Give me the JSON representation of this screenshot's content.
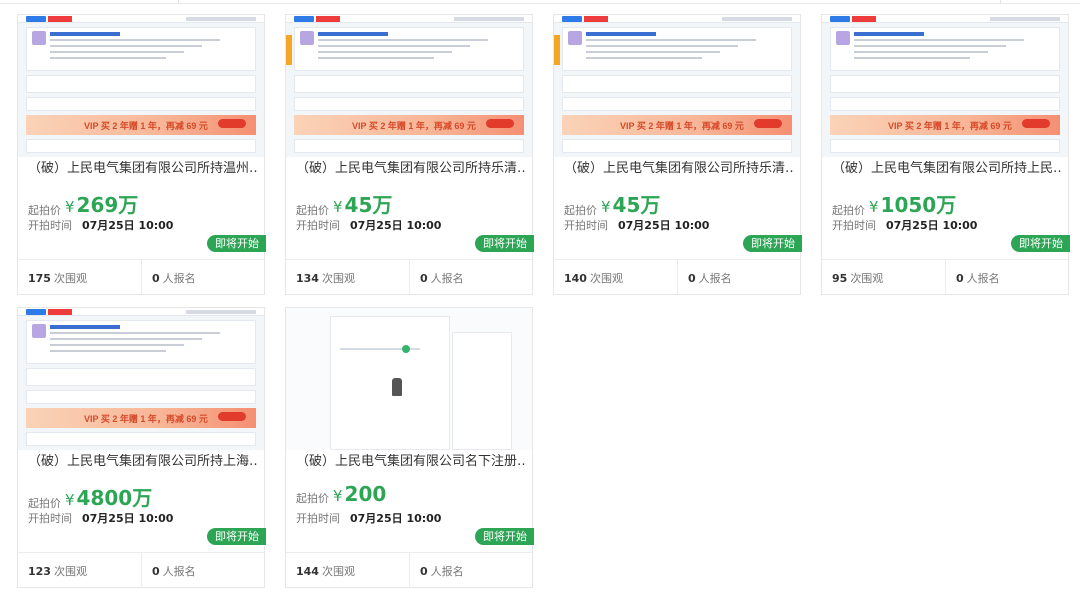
{
  "auctions": [
    {
      "title": "（破）上民电气集团有限公司所持温州…",
      "price_label": "起拍价",
      "currency": "¥",
      "price": "269万",
      "time_label": "开拍时间",
      "time": "07月25日 10:00",
      "status": "即将开始",
      "views": "175",
      "views_label": "次围观",
      "signups": "0",
      "signups_label": "人报名"
    },
    {
      "title": "（破）上民电气集团有限公司所持乐清…",
      "price_label": "起拍价",
      "currency": "¥",
      "price": "45万",
      "time_label": "开拍时间",
      "time": "07月25日 10:00",
      "status": "即将开始",
      "views": "134",
      "views_label": "次围观",
      "signups": "0",
      "signups_label": "人报名"
    },
    {
      "title": "（破）上民电气集团有限公司所持乐清…",
      "price_label": "起拍价",
      "currency": "¥",
      "price": "45万",
      "time_label": "开拍时间",
      "time": "07月25日 10:00",
      "status": "即将开始",
      "views": "140",
      "views_label": "次围观",
      "signups": "0",
      "signups_label": "人报名"
    },
    {
      "title": "（破）上民电气集团有限公司所持上民…",
      "price_label": "起拍价",
      "currency": "¥",
      "price": "1050万",
      "time_label": "开拍时间",
      "time": "07月25日 10:00",
      "status": "即将开始",
      "views": "95",
      "views_label": "次围观",
      "signups": "0",
      "signups_label": "人报名"
    },
    {
      "title": "（破）上民电气集团有限公司所持上海…",
      "price_label": "起拍价",
      "currency": "¥",
      "price": "4800万",
      "time_label": "开拍时间",
      "time": "07月25日 10:00",
      "status": "即将开始",
      "views": "123",
      "views_label": "次围观",
      "signups": "0",
      "signups_label": "人报名"
    },
    {
      "title": "（破）上民电气集团有限公司名下注册…",
      "price_label": "起拍价",
      "currency": "¥",
      "price": "200",
      "time_label": "开拍时间",
      "time": "07月25日 10:00",
      "status": "即将开始",
      "views": "144",
      "views_label": "次围观",
      "signups": "0",
      "signups_label": "人报名"
    }
  ],
  "thumbnail_banner": "VIP 买 2 年赠 1 年，再减 69 元",
  "colors": {
    "accent_green": "#2ca655",
    "vip_red": "#d64a2a",
    "brand_blue": "#2e7be8"
  }
}
